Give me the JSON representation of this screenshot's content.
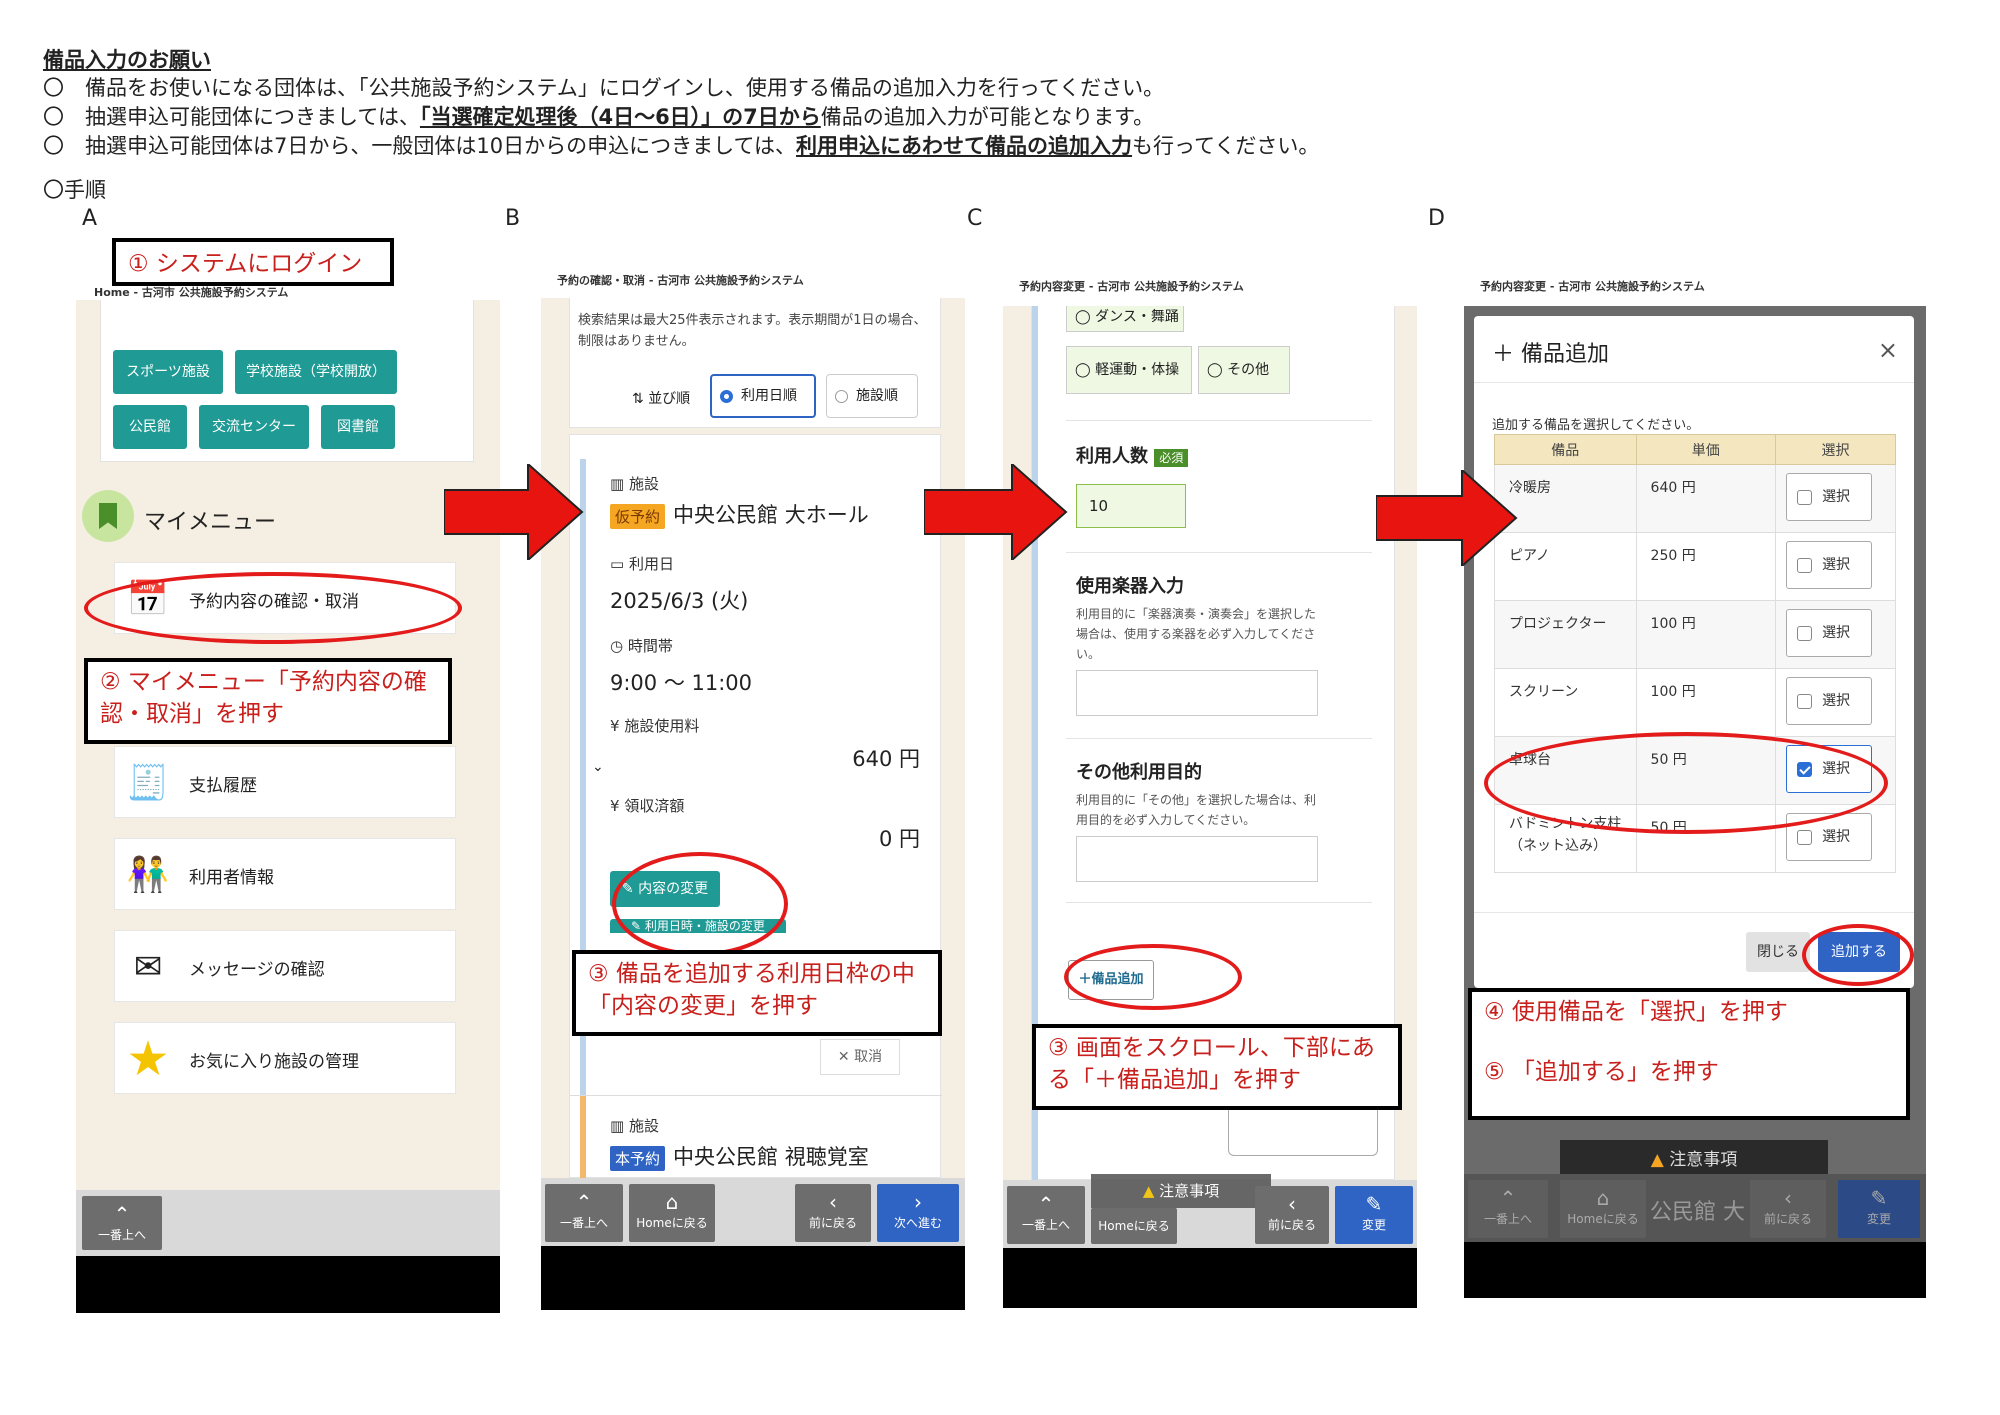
{
  "intro": {
    "title": "備品入力のお願い",
    "line1": "〇　備品をお使いになる団体は、「公共施設予約システム」にログインし、使用する備品の追加入力を行ってください。",
    "line2_pre": "〇　抽選申込可能団体につきましては、",
    "line2_bold": "「当選確定処理後（4日～6日）」の7日から",
    "line2_post": "備品の追加入力が可能となります。",
    "line3_pre": "〇　抽選申込可能団体は7日から、一般団体は10日からの申込につきましては、",
    "line3_bold": "利用申込にあわせて備品の追加入力",
    "line3_post": "も行ってください。",
    "steps": "〇手順"
  },
  "columns": {
    "a": "A",
    "b": "B",
    "c": "C",
    "d": "D"
  },
  "callouts": {
    "c1": "① システムにログイン",
    "c2": "② マイメニュー「予約内容の確認・取消」を押す",
    "c3b": "③ 備品を追加する利用日枠の中「内容の変更」を押す",
    "c3c": "③ 画面をスクロール、下部にある「＋備品追加」を押す",
    "c4": "④ 使用備品を「選択」を押す",
    "c5": "⑤ 「追加する」を押す"
  },
  "phone_a": {
    "title": "Home - 古河市 公共施設予約システム",
    "tags": [
      "スポーツ施設",
      "学校施設（学校開放）",
      "公民館",
      "交流センター",
      "図書館"
    ],
    "mymenu": "マイメニュー",
    "menu": [
      "予約内容の確認・取消",
      "支払履歴",
      "利用者情報",
      "メッセージの確認",
      "お気に入り施設の管理"
    ],
    "nav_top": "一番上へ"
  },
  "phone_b": {
    "title": "予約の確認・取消 - 古河市 公共施設予約システム",
    "note": "検索結果は最大25件表示されます。表示期間が1日の場合、制限はありません。",
    "sort_label": "並び順",
    "sort_opt1": "利用日順",
    "sort_opt2": "施設順",
    "lbl_facility": "施設",
    "badge_tentative": "仮予約",
    "facility1": "中央公民館 大ホール",
    "lbl_date": "利用日",
    "date": "2025/6/3 (火)",
    "lbl_time": "時間帯",
    "time": "9:00 ～ 11:00",
    "lbl_fee": "施設使用料",
    "fee": "640 円",
    "lbl_received": "領収済額",
    "received": "0 円",
    "btn_change": "内容の変更",
    "btn_date_change": "利用日時・施設の変更",
    "btn_cancel": "取消",
    "badge_confirmed": "本予約",
    "facility2": "中央公民館 視聴覚室",
    "nav": [
      "一番上へ",
      "Homeに戻る",
      "前に戻る",
      "次へ進む"
    ]
  },
  "phone_c": {
    "title": "予約内容変更 - 古河市 公共施設予約システム",
    "purpose1": "ダンス・舞踊",
    "purpose2": "軽運動・体操",
    "purpose3": "その他",
    "users_label": "利用人数",
    "required": "必須",
    "users_value": "10",
    "inst_label": "使用楽器入力",
    "inst_help": "利用目的に「楽器演奏・演奏会」を選択した場合は、使用する楽器を必ず入力してください。",
    "other_label": "その他利用目的",
    "other_help": "利用目的に「その他」を選択した場合は、利用目的を必ず入力してください。",
    "add_btn": "＋備品追加",
    "notice": "注意事項",
    "nav": [
      "一番上へ",
      "Homeに戻る",
      "前に戻る",
      "変更"
    ]
  },
  "phone_d": {
    "title": "予約内容変更 - 古河市 公共施設予約システム",
    "modal_title": "備品追加",
    "instr": "追加する備品を選択してください。",
    "headers": [
      "備品",
      "単価",
      "選択"
    ],
    "rows": [
      {
        "name": "冷暖房",
        "price": "640 円",
        "sel": "選択",
        "checked": false
      },
      {
        "name": "ピアノ",
        "price": "250 円",
        "sel": "選択",
        "checked": false
      },
      {
        "name": "プロジェクター",
        "price": "100 円",
        "sel": "選択",
        "checked": false
      },
      {
        "name": "スクリーン",
        "price": "100 円",
        "sel": "選択",
        "checked": false
      },
      {
        "name": "卓球台",
        "price": "50 円",
        "sel": "選択",
        "checked": true
      },
      {
        "name": "バドミントン支柱（ネット込み）",
        "price": "50 円",
        "sel": "選択",
        "checked": false
      }
    ],
    "close_btn": "閉じる",
    "add_btn": "追加する",
    "notice": "注意事項",
    "bg_text": "公民館 大",
    "nav": [
      "一番上へ",
      "Homeに戻る",
      "前に戻る",
      "変更"
    ]
  },
  "colors": {
    "accent_red": "#e31b1b",
    "teal": "#1f9a94",
    "blue": "#2f64c4"
  }
}
